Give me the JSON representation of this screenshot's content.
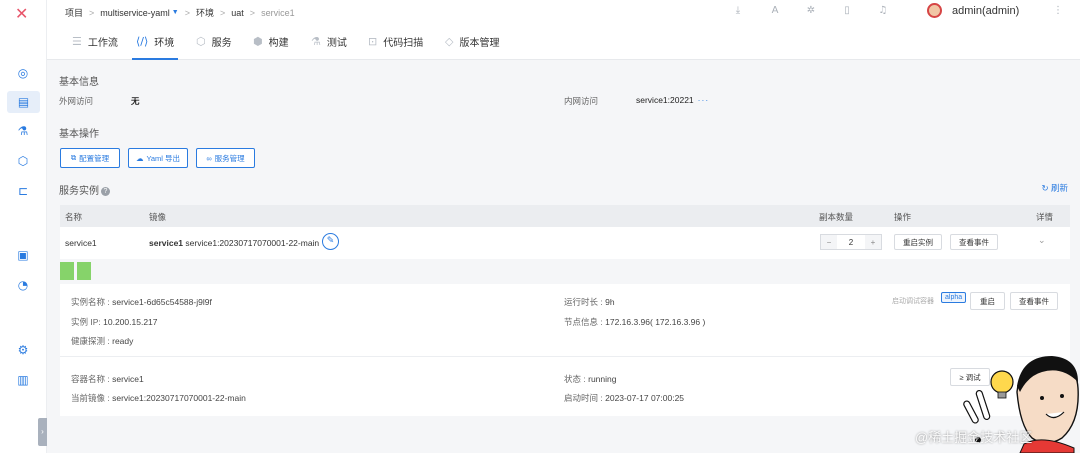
{
  "brand": {
    "logo": "✕",
    "color": "#e8556a"
  },
  "sidebar": {
    "items": [
      {
        "name": "dashboard-icon",
        "glyph": "◎"
      },
      {
        "name": "project-icon",
        "glyph": "▤"
      },
      {
        "name": "test-icon",
        "glyph": "⚗"
      },
      {
        "name": "artifact-icon",
        "glyph": "⬡"
      },
      {
        "name": "workflow-icon",
        "glyph": "⊏"
      },
      {
        "name": "monitor-icon",
        "glyph": "▣"
      },
      {
        "name": "insight-icon",
        "glyph": "◔"
      },
      {
        "name": "settings-icon",
        "glyph": "⚙"
      },
      {
        "name": "plugin-icon",
        "glyph": "▥"
      }
    ],
    "collapse": "›"
  },
  "breadcrumb": {
    "project": "项目",
    "project_name": "multiservice-yaml",
    "env": "环境",
    "env_name": "uat",
    "service": "service1",
    "sep": ">"
  },
  "header_icons": [
    "download-icon",
    "translate-icon",
    "share-icon",
    "book-icon",
    "bell-icon"
  ],
  "user": {
    "name": "admin(admin)"
  },
  "tabs": [
    {
      "label": "工作流",
      "icon": "☰",
      "name": "tab-workflow"
    },
    {
      "label": "环境",
      "icon": "⟨/⟩",
      "name": "tab-environment",
      "active": true
    },
    {
      "label": "服务",
      "icon": "⬡",
      "name": "tab-service"
    },
    {
      "label": "构建",
      "icon": "⬢",
      "name": "tab-build"
    },
    {
      "label": "测试",
      "icon": "⚗",
      "name": "tab-test"
    },
    {
      "label": "代码扫描",
      "icon": "⊡",
      "name": "tab-code-scan"
    },
    {
      "label": "版本管理",
      "icon": "◇",
      "name": "tab-version"
    }
  ],
  "basic_info": {
    "title": "基本信息",
    "external_label": "外网访问",
    "external_value": "无",
    "internal_label": "内网访问",
    "internal_value": "service1:20221",
    "more": "···"
  },
  "basic_ops": {
    "title": "基本操作",
    "buttons": [
      {
        "label": "配置管理",
        "icon": "⧉"
      },
      {
        "label": "Yaml 导出",
        "icon": "☁"
      },
      {
        "label": "服务管理",
        "icon": "∞"
      }
    ]
  },
  "instances": {
    "title": "服务实例",
    "help": "?",
    "refresh": "↻ 刷新",
    "columns": [
      "名称",
      "镜像",
      "副本数量",
      "操作",
      "详情"
    ],
    "rows": [
      {
        "name": "service1",
        "image_bold": "service1",
        "image": "service1:20230717070001-22-main",
        "replicas": "2",
        "minus": "−",
        "plus": "+",
        "restart": "重启实例",
        "events": "查看事件",
        "pods_count": 2
      }
    ]
  },
  "pod_detail": {
    "instance_name_label": "实例名称 :",
    "instance_name": "service1-6d65c54588-j9l9f",
    "instance_ip_label": "实例 IP:",
    "instance_ip": "10.200.15.217",
    "health_label": "健康探测 :",
    "health": "ready",
    "runtime_label": "运行时长 :",
    "runtime": "9h",
    "node_label": "节点信息 :",
    "node": "172.16.3.96( 172.16.3.96 )",
    "debug_label": "启动调试容器",
    "alpha": "alpha",
    "restart": "重启",
    "events": "查看事件",
    "container_label": "容器名称 :",
    "container": "service1",
    "image_label": "当前镜像 :",
    "image": "service1:20230717070001-22-main",
    "status_label": "状态 :",
    "status": "running",
    "start_label": "启动时间 :",
    "start": "2023-07-17 07:00:25",
    "container_btn": "≥ 调试"
  },
  "watermark": "@稀土掘金技术社区",
  "colors": {
    "accent": "#2a7be0",
    "pod": "#86d36a",
    "header_bg": "#ebedf0"
  }
}
